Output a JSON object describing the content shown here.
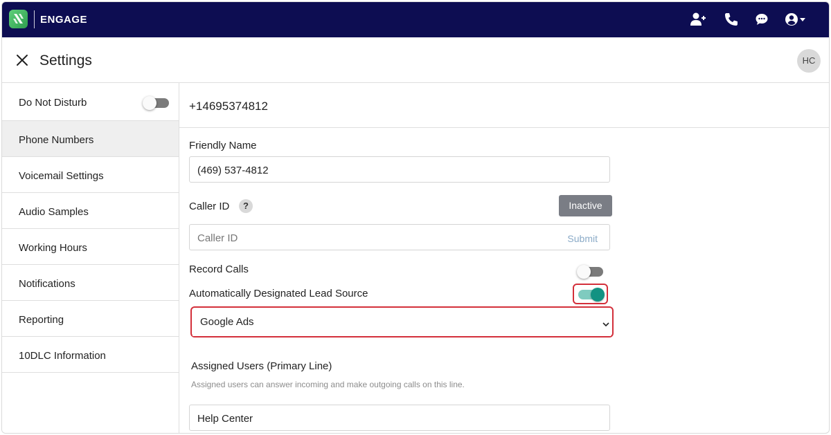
{
  "app": {
    "brand": "ENGAGE",
    "icons": [
      "add-user-icon",
      "phone-icon",
      "chat-icon",
      "account-icon"
    ]
  },
  "header": {
    "title": "Settings",
    "avatar_initials": "HC"
  },
  "sidebar": {
    "items": [
      {
        "label": "Do Not Disturb",
        "toggle": false
      },
      {
        "label": "Phone Numbers",
        "active": true
      },
      {
        "label": "Voicemail Settings"
      },
      {
        "label": "Audio Samples"
      },
      {
        "label": "Working Hours"
      },
      {
        "label": "Notifications"
      },
      {
        "label": "Reporting"
      },
      {
        "label": "10DLC Information"
      }
    ]
  },
  "main": {
    "phone_number": "+14695374812",
    "friendly_name": {
      "label": "Friendly Name",
      "value": "(469) 537-4812"
    },
    "caller_id": {
      "label": "Caller ID",
      "help": "?",
      "status_button": "Inactive",
      "placeholder": "Caller ID",
      "submit": "Submit"
    },
    "record_calls": {
      "label": "Record Calls",
      "enabled": false
    },
    "lead_source": {
      "label": "Automatically Designated Lead Source",
      "enabled": true,
      "selected": "Google Ads"
    },
    "assigned_users": {
      "label": "Assigned Users (Primary Line)",
      "help_text": "Assigned users can answer incoming and make outgoing calls on this line.",
      "value": "Help Center"
    }
  },
  "colors": {
    "topbar": "#0d0d52",
    "toggle_on": "#129282",
    "highlight": "#d32f3a",
    "inactive_button": "#7a7d85"
  }
}
